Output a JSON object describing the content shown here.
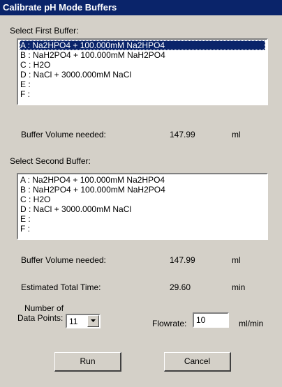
{
  "window": {
    "title": "Calibrate pH Mode Buffers"
  },
  "first": {
    "label": "Select First Buffer:",
    "items": [
      "A : Na2HPO4 + 100.000mM Na2HPO4",
      "B : NaH2PO4 + 100.000mM NaH2PO4",
      "C : H2O",
      "D : NaCl + 3000.000mM NaCl",
      "E :",
      "F :"
    ],
    "selected": "A : Na2HPO4 + 100.000mM Na2HPO4",
    "volume_label": "Buffer Volume needed:",
    "volume_value": "147.99",
    "volume_unit": "ml"
  },
  "second": {
    "label": "Select Second Buffer:",
    "items": [
      "A : Na2HPO4 + 100.000mM Na2HPO4",
      "B : NaH2PO4 + 100.000mM NaH2PO4",
      "C : H2O",
      "D : NaCl + 3000.000mM NaCl",
      "E :",
      "F :"
    ],
    "volume_label": "Buffer Volume needed:",
    "volume_value": "147.99",
    "volume_unit": "ml"
  },
  "time": {
    "label": "Estimated Total Time:",
    "value": "29.60",
    "unit": "min"
  },
  "datapoints": {
    "label_line1": "Number of",
    "label_line2": "Data Points:",
    "value": "11",
    "icon": "dropdown-arrow-icon"
  },
  "flowrate": {
    "label": "Flowrate:",
    "value": "10",
    "unit": "ml/min"
  },
  "buttons": {
    "run": "Run",
    "cancel": "Cancel"
  },
  "colors": {
    "face": "#d4d0c8",
    "title_bar": "#0a246a",
    "selection": "#0a246a"
  }
}
